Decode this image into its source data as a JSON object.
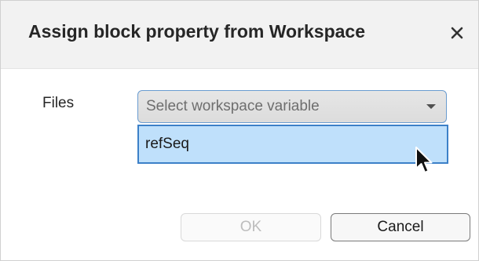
{
  "dialog": {
    "title": "Assign block property from Workspace",
    "close_icon": "close-icon"
  },
  "form": {
    "files_label": "Files",
    "select": {
      "placeholder": "Select workspace variable",
      "caret_icon": "chevron-down-icon",
      "options": [
        "refSeq"
      ],
      "highlighted_option": "refSeq",
      "is_open": true
    }
  },
  "buttons": {
    "ok_label": "OK",
    "ok_enabled": false,
    "cancel_label": "Cancel"
  },
  "colors": {
    "titlebar_bg": "#f2f2f2",
    "select_border": "#6a9cd0",
    "option_highlight_bg": "#bfe0fb",
    "option_highlight_border": "#3c80c8",
    "disabled_text": "#bdbdbd"
  },
  "cursor_icon": "mouse-pointer-icon"
}
